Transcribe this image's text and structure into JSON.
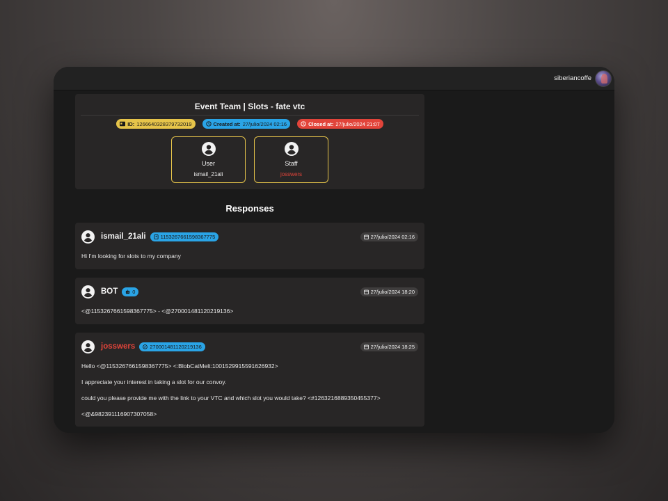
{
  "topbar": {
    "username": "siberiancoffe"
  },
  "event": {
    "title": "Event Team | Slots - fate vtc",
    "id_label": "ID:",
    "id_value": "1266640328379732019",
    "created_label": "Created at:",
    "created_value": "27/julio/2024 02:16",
    "closed_label": "Closed at:",
    "closed_value": "27/julio/2024 21:07",
    "user": {
      "role": "User",
      "name": "ismail_21ali"
    },
    "staff": {
      "role": "Staff",
      "name": "josswers"
    }
  },
  "responses_title": "Responses",
  "messages": [
    {
      "author": "ismail_21ali",
      "id": "1153267661598367775",
      "time": "27/julio/2024 02:16",
      "lines": [
        "Hi I'm looking for slots to my company"
      ]
    },
    {
      "author": "BOT",
      "id": "0",
      "time": "27/julio/2024 18:20",
      "lines": [
        "<@1153267661598367775> - <@270001481120219136>"
      ]
    },
    {
      "author": "josswers",
      "id": "270001481120219136",
      "time": "27/julio/2024 18:25",
      "lines": [
        "Hello <@1153267661598367775> <:BlobCatMelt:1001529915591626932>",
        "I appreciate your interest in taking a slot for our convoy.",
        "could you please provide me with the link to your VTC and which slot you would take? <#1263216889350455377>",
        "<@&982391116907307058>"
      ]
    }
  ],
  "colors": {
    "accent_yellow": "#e6c44a",
    "accent_blue": "#2aa4e6",
    "accent_red": "#e2443a",
    "card_bg": "#282626"
  },
  "icons": [
    "user-circle-icon",
    "id-card-icon",
    "clock-icon",
    "calendar-icon",
    "id-badge-icon",
    "robot-icon"
  ]
}
